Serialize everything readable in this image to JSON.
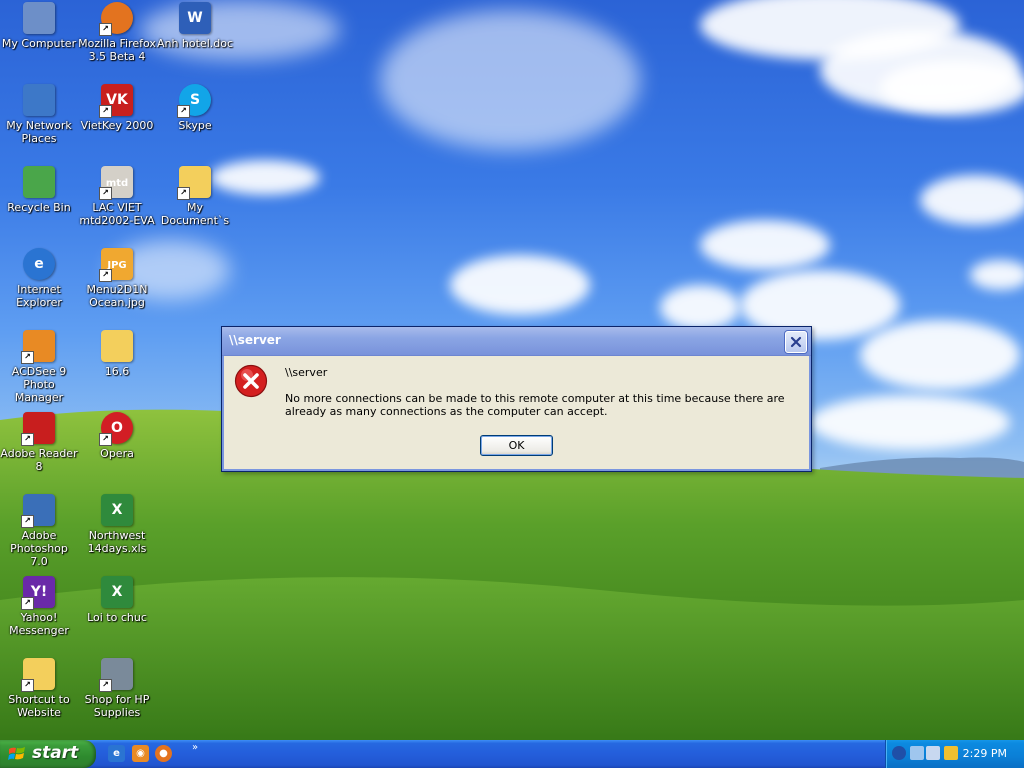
{
  "desktop": {
    "icons": [
      {
        "label": "My Computer",
        "glyph": "computer-icon",
        "color": "#6d8fc8"
      },
      {
        "label": "Mozilla Firefox 3.5 Beta 4",
        "glyph": "firefox-icon",
        "color": "#e3731f"
      },
      {
        "label": "Anh hotel.doc",
        "glyph": "word-document-icon",
        "color": "#2e5fb8"
      },
      {
        "label": "My Network Places",
        "glyph": "network-places-icon",
        "color": "#3d78c8"
      },
      {
        "label": "VietKey 2000",
        "glyph": "vietkey-icon",
        "color": "#c8201e"
      },
      {
        "label": "Skype",
        "glyph": "skype-icon",
        "color": "#12a5e8"
      },
      {
        "label": "Recycle Bin",
        "glyph": "recycle-bin-icon",
        "color": "#4aa64a"
      },
      {
        "label": "LAC VIET mtd2002-EVA",
        "glyph": "lac-viet-icon",
        "color": "#d4d0c8"
      },
      {
        "label": "My Document`s",
        "glyph": "folder-icon",
        "color": "#f3cf5c"
      },
      {
        "label": "Internet Explorer",
        "glyph": "internet-explorer-icon",
        "color": "#2a74d2"
      },
      {
        "label": "Menu2D1N Ocean.jpg",
        "glyph": "jpg-image-icon",
        "color": "#f0a830"
      },
      {
        "label": "ACDSee 9 Photo Manager",
        "glyph": "acdsee-icon",
        "color": "#e88a24"
      },
      {
        "label": "16.6",
        "glyph": "folder-icon",
        "color": "#f3cf5c"
      },
      {
        "label": "Adobe Reader 8",
        "glyph": "adobe-reader-icon",
        "color": "#c81e1e"
      },
      {
        "label": "Opera",
        "glyph": "opera-icon",
        "color": "#d21e24"
      },
      {
        "label": "Adobe Photoshop 7.0",
        "glyph": "photoshop-icon",
        "color": "#3a6fb8"
      },
      {
        "label": "Northwest 14days.xls",
        "glyph": "excel-document-icon",
        "color": "#2f8a3c"
      },
      {
        "label": "Yahoo! Messenger",
        "glyph": "yahoo-messenger-icon",
        "color": "#6a2aa8"
      },
      {
        "label": "Loi to chuc",
        "glyph": "excel-document-icon",
        "color": "#2f8a3c"
      },
      {
        "label": "Shortcut to Website",
        "glyph": "folder-icon",
        "color": "#f3cf5c"
      },
      {
        "label": "Shop for HP Supplies",
        "glyph": "hp-supplies-icon",
        "color": "#7a8a9a"
      }
    ],
    "icon_glyph_letters": [
      "",
      "",
      "W",
      "",
      "VK",
      "S",
      "",
      "mtd",
      "",
      "e",
      "JPG",
      "",
      "",
      "",
      "O",
      "",
      "X",
      "Y!",
      "X",
      "",
      ""
    ]
  },
  "dialog": {
    "title": "\\\\server",
    "message_title": "\\\\server",
    "message": "No more connections can be made to this remote computer at this time because there are already as many connections as the computer can accept.",
    "ok_label": "OK"
  },
  "taskbar": {
    "start_label": "start",
    "quick_launch_more": "»",
    "clock": "2:29 PM"
  },
  "colors": {
    "dialog_border": "#0a246a",
    "dialog_face": "#ece9d8",
    "start_green": "#3b9c3a",
    "taskbar_blue": "#245edb",
    "tray_blue": "#0b7fd6",
    "error_red": "#d42020"
  }
}
